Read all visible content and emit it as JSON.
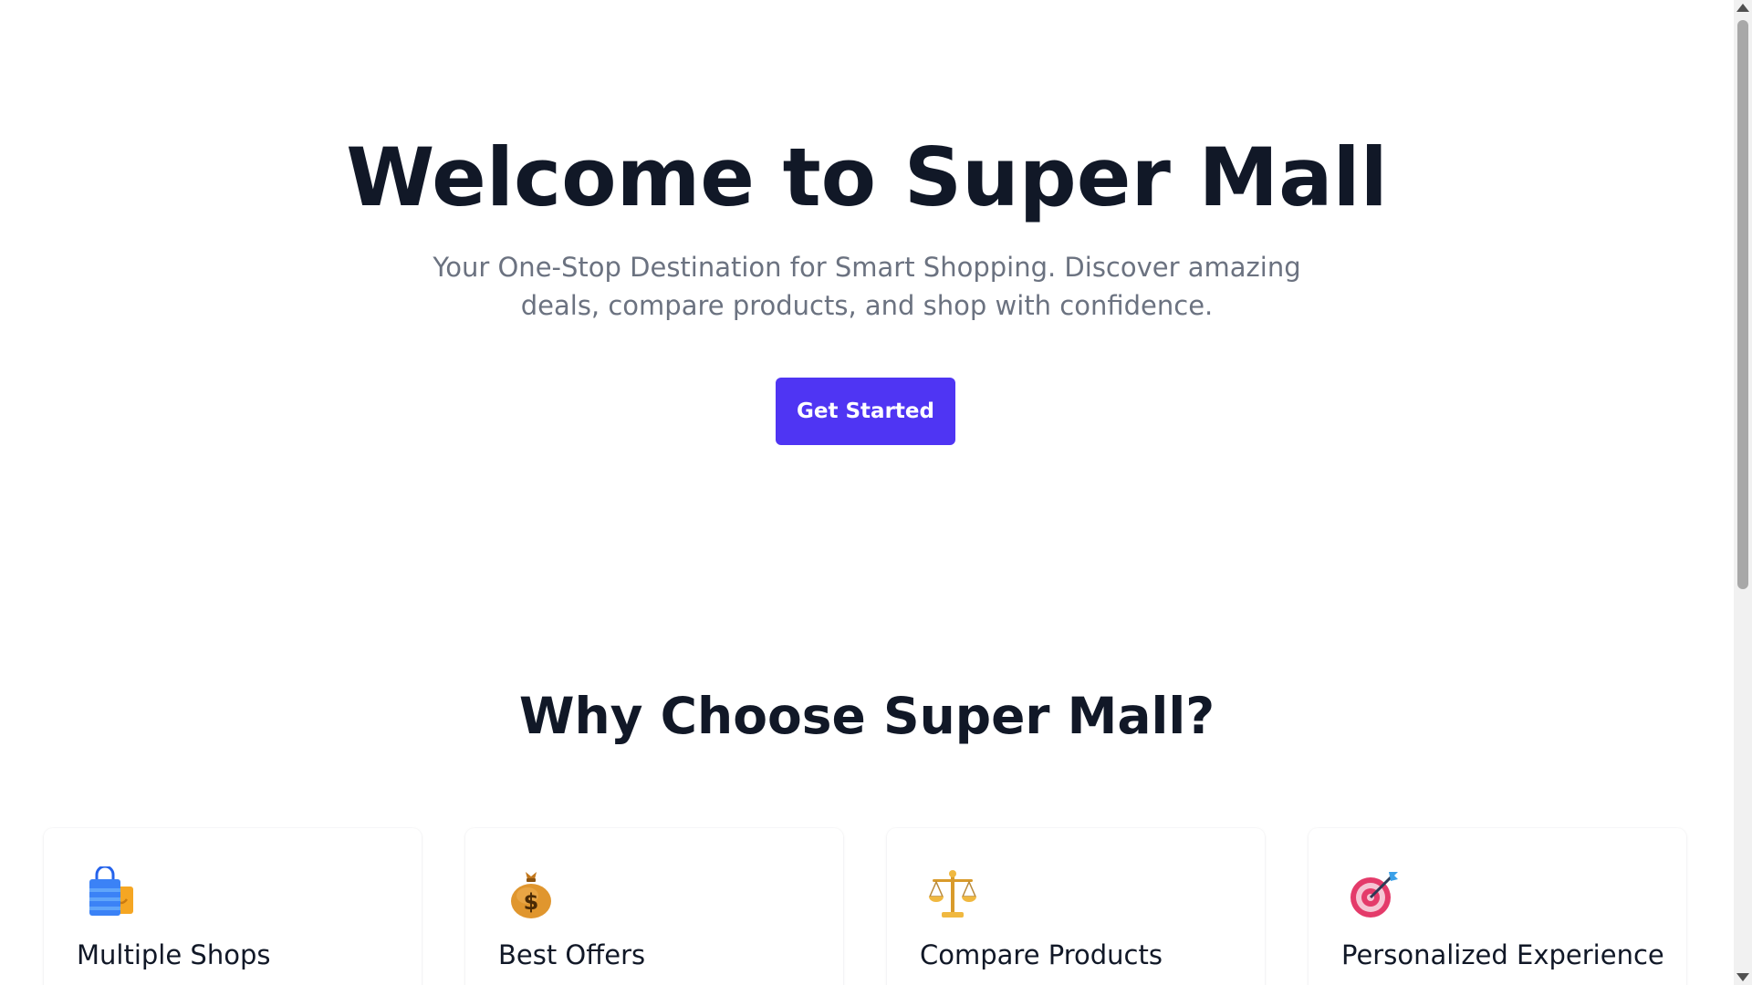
{
  "hero": {
    "title": "Welcome to Super Mall",
    "subtitle": "Your One-Stop Destination for Smart Shopping. Discover amazing deals, compare products, and shop with confidence.",
    "cta_label": "Get Started"
  },
  "features": {
    "title": "Why Choose Super Mall?",
    "items": [
      {
        "icon": "shopping-bags-icon",
        "title": "Multiple Shops"
      },
      {
        "icon": "money-bag-icon",
        "title": "Best Offers"
      },
      {
        "icon": "balance-scale-icon",
        "title": "Compare Products"
      },
      {
        "icon": "bullseye-target-icon",
        "title": "Personalized Experience"
      }
    ]
  },
  "colors": {
    "accent": "#4f35f3",
    "heading": "#111827",
    "muted_text": "#6b7280"
  }
}
